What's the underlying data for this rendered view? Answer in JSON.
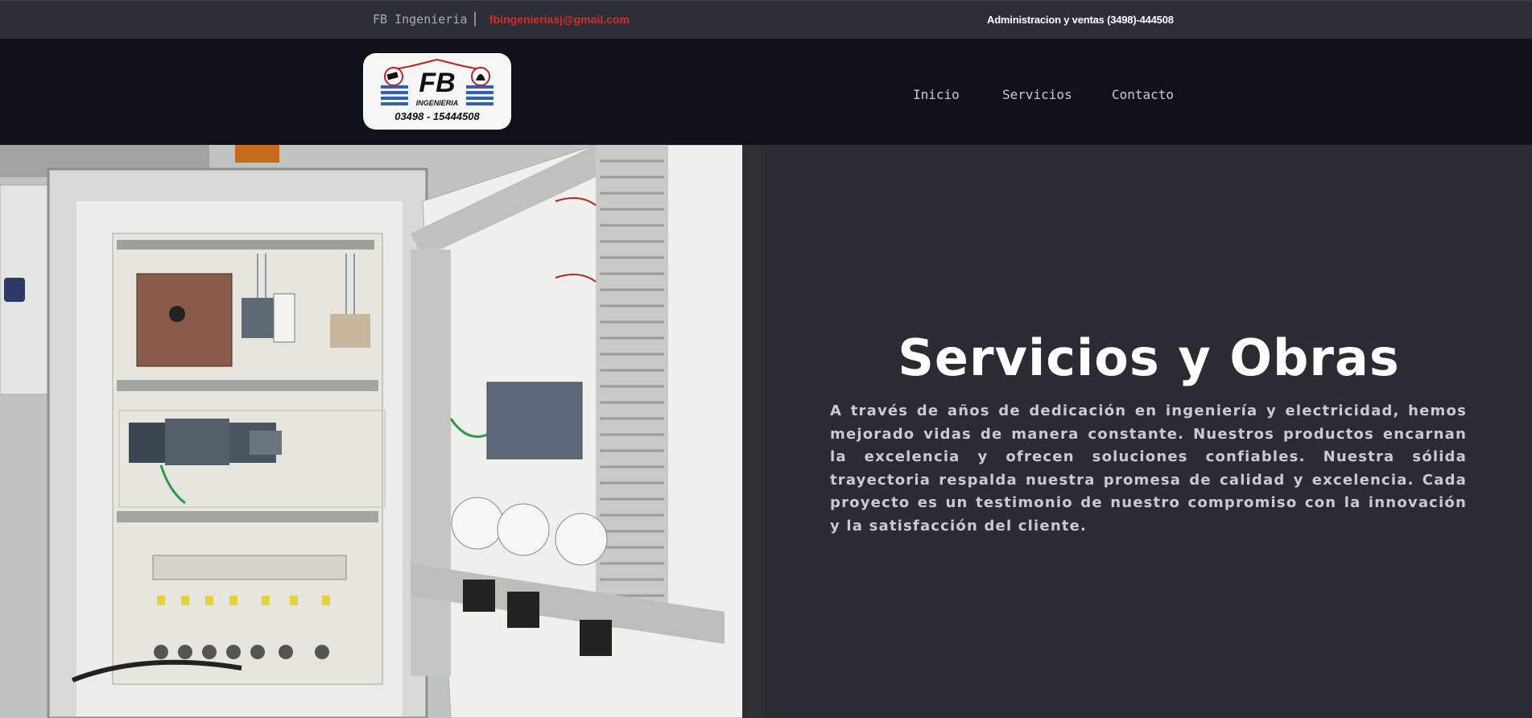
{
  "topbar": {
    "brand": "FB Ingenieria",
    "separator": "|",
    "email": "fbingenieriasj@gmail.com",
    "phone": "Administracion y ventas (3498)-444508"
  },
  "logo": {
    "letters": "FB",
    "subtitle": "INGENIERIA",
    "phone": "03498 - 15444508"
  },
  "nav": {
    "items": [
      "Inicio",
      "Servicios",
      "Contacto"
    ]
  },
  "hero": {
    "title": "Servicios y Obras",
    "body": "A través de años de dedicación en ingeniería y electricidad, hemos mejorado vidas de manera constante. Nuestros productos encarnan la excelencia y ofrecen soluciones confiables. Nuestra sólida trayectoria respalda nuestra promesa de calidad y excelencia. Cada proyecto es un testimonio de nuestro compromiso con la innovación y la satisfacción del cliente."
  },
  "colors": {
    "topbar_bg": "#2b2f37",
    "navbar_bg": "#0e131a",
    "hero_bg": "#2a2b33",
    "email_accent": "#d62b2b"
  }
}
